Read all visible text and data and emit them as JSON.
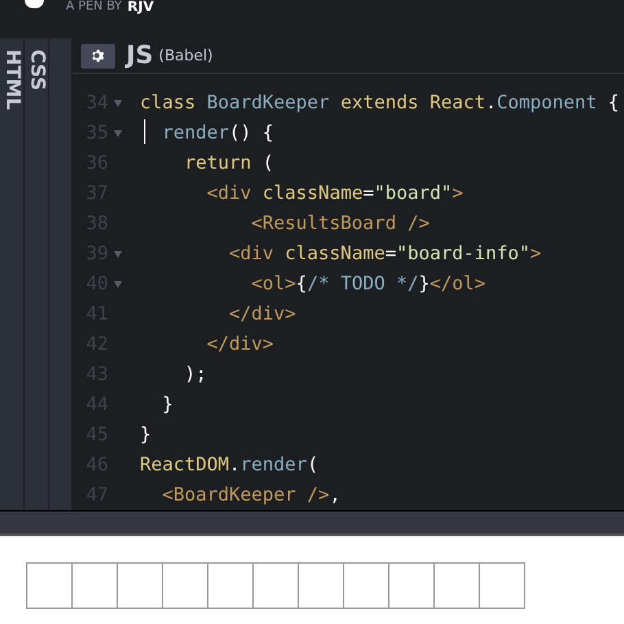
{
  "header": {
    "byline": "A PEN BY",
    "author": "RJV"
  },
  "side_tabs": [
    {
      "label": "HTML",
      "selected": false
    },
    {
      "label": "CSS",
      "selected": false
    }
  ],
  "editor": {
    "title": "JS",
    "subtitle": "(Babel)",
    "lines": [
      {
        "number": "34",
        "fold": true,
        "cursor": false,
        "tokens": [
          {
            "t": "class ",
            "kind": "keyword"
          },
          {
            "t": "BoardKeeper ",
            "kind": "name"
          },
          {
            "t": "extends ",
            "kind": "keyword"
          },
          {
            "t": "React",
            "kind": "keyword"
          },
          {
            "t": ".",
            "kind": "punct"
          },
          {
            "t": "Component ",
            "kind": "name"
          },
          {
            "t": "{",
            "kind": "punct"
          }
        ]
      },
      {
        "number": "35",
        "fold": true,
        "cursor": true,
        "tokens": [
          {
            "t": "  render",
            "kind": "name"
          },
          {
            "t": "() {",
            "kind": "punct"
          }
        ]
      },
      {
        "number": "36",
        "fold": false,
        "cursor": false,
        "tokens": [
          {
            "t": "    return ",
            "kind": "keyword"
          },
          {
            "t": "(",
            "kind": "punct"
          }
        ]
      },
      {
        "number": "37",
        "fold": false,
        "cursor": false,
        "tokens": [
          {
            "t": "      <div ",
            "kind": "tag"
          },
          {
            "t": "className",
            "kind": "attr"
          },
          {
            "t": "=",
            "kind": "punct"
          },
          {
            "t": "\"board\"",
            "kind": "string"
          },
          {
            "t": ">",
            "kind": "tag"
          }
        ]
      },
      {
        "number": "38",
        "fold": false,
        "cursor": false,
        "tokens": [
          {
            "t": "          <ResultsBoard />",
            "kind": "tag"
          }
        ]
      },
      {
        "number": "39",
        "fold": true,
        "cursor": false,
        "tokens": [
          {
            "t": "        <div ",
            "kind": "tag"
          },
          {
            "t": "className",
            "kind": "attr"
          },
          {
            "t": "=",
            "kind": "punct"
          },
          {
            "t": "\"board-info\"",
            "kind": "string"
          },
          {
            "t": ">",
            "kind": "tag"
          }
        ]
      },
      {
        "number": "40",
        "fold": true,
        "cursor": false,
        "tokens": [
          {
            "t": "          <ol>",
            "kind": "tag"
          },
          {
            "t": "{",
            "kind": "punct"
          },
          {
            "t": "/* TODO */",
            "kind": "comment"
          },
          {
            "t": "}",
            "kind": "punct"
          },
          {
            "t": "</ol>",
            "kind": "tag"
          }
        ]
      },
      {
        "number": "41",
        "fold": false,
        "cursor": false,
        "tokens": [
          {
            "t": "        </div>",
            "kind": "tag"
          }
        ]
      },
      {
        "number": "42",
        "fold": false,
        "cursor": false,
        "tokens": [
          {
            "t": "      </div>",
            "kind": "tag"
          }
        ]
      },
      {
        "number": "43",
        "fold": false,
        "cursor": false,
        "tokens": [
          {
            "t": "    );",
            "kind": "punct"
          }
        ]
      },
      {
        "number": "44",
        "fold": false,
        "cursor": false,
        "tokens": [
          {
            "t": "  }",
            "kind": "punct"
          }
        ]
      },
      {
        "number": "45",
        "fold": false,
        "cursor": false,
        "tokens": [
          {
            "t": "}",
            "kind": "punct"
          }
        ]
      },
      {
        "number": "46",
        "fold": false,
        "cursor": false,
        "tokens": [
          {
            "t": "ReactDOM",
            "kind": "keyword"
          },
          {
            "t": ".",
            "kind": "punct"
          },
          {
            "t": "render",
            "kind": "name"
          },
          {
            "t": "(",
            "kind": "punct"
          }
        ]
      },
      {
        "number": "47",
        "fold": false,
        "cursor": false,
        "tokens": [
          {
            "t": "  <BoardKeeper />",
            "kind": "tag"
          },
          {
            "t": ",",
            "kind": "punct"
          }
        ]
      }
    ]
  }
}
